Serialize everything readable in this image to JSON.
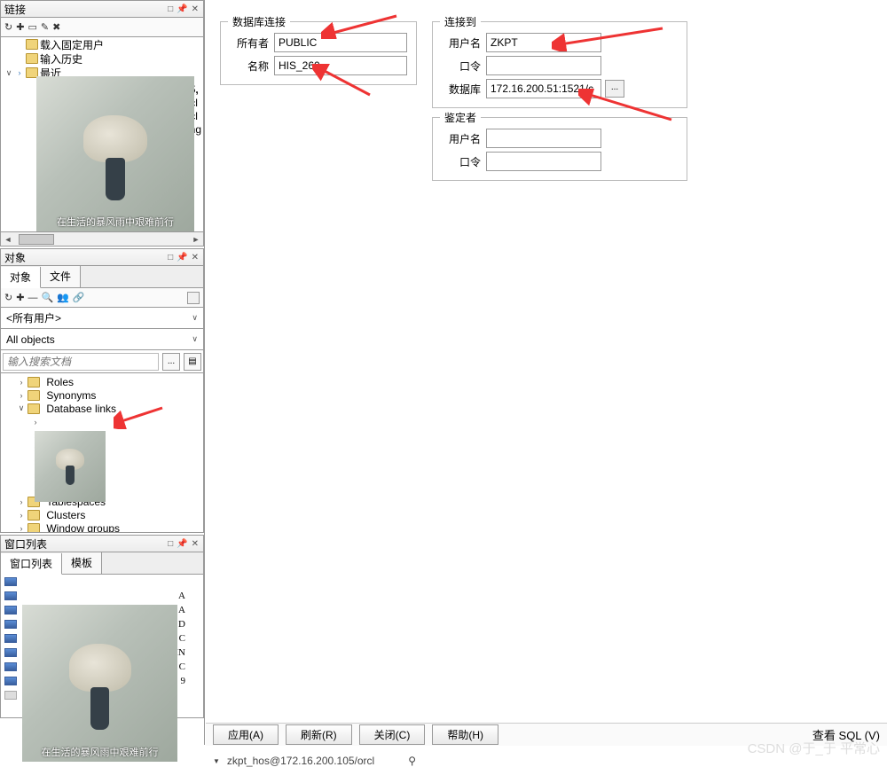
{
  "panels": {
    "connections": {
      "title": "链接"
    },
    "objects": {
      "title": "对象"
    },
    "windowlist": {
      "title": "窗口列表"
    }
  },
  "conn_tree": {
    "items": [
      {
        "label": "载入固定用户"
      },
      {
        "label": "输入历史"
      },
      {
        "label": "最近"
      }
    ],
    "partial1": "105,",
    "partial2": "/orcl",
    "partial3": "/orcl",
    "partial4": "uang"
  },
  "obj_tabs": {
    "t1": "对象",
    "t2": "文件"
  },
  "obj_filters": {
    "users": "<所有用户>",
    "objects": "All objects"
  },
  "obj_search": {
    "placeholder": "输入搜索文档"
  },
  "obj_tree": {
    "roles": "Roles",
    "synonyms": "Synonyms",
    "dblinks": "Database links",
    "tablespaces": "Tablespaces",
    "clusters": "Clusters",
    "wingroups": "Window groups"
  },
  "win_tabs": {
    "t1": "窗口列表",
    "t2": "模板"
  },
  "win_rows": [
    "A",
    "A",
    "D",
    "C",
    "IN",
    "C",
    "9"
  ],
  "group1": {
    "title": "数据库连接",
    "owner_label": "所有者",
    "owner_value": "PUBLIC",
    "name_label": "名称",
    "name_value": "HIS_260"
  },
  "group2": {
    "title": "连接到",
    "user_label": "用户名",
    "user_value": "ZKPT",
    "pwd_label": "口令",
    "pwd_value": "",
    "db_label": "数据库",
    "db_value": "172.16.200.51:1521/c"
  },
  "group3": {
    "title": "鉴定者",
    "user_label": "用户名",
    "pwd_label": "口令"
  },
  "buttons": {
    "apply": "应用(A)",
    "refresh": "刷新(R)",
    "close": "关闭(C)",
    "help": "帮助(H)",
    "viewsql": "查看 SQL (V)"
  },
  "status": {
    "conn": "zkpt_hos@172.16.200.105/orcl"
  },
  "watermark": "CSDN @于_于 平常心",
  "meme_caption": "在生活的暴风雨中艰难前行"
}
